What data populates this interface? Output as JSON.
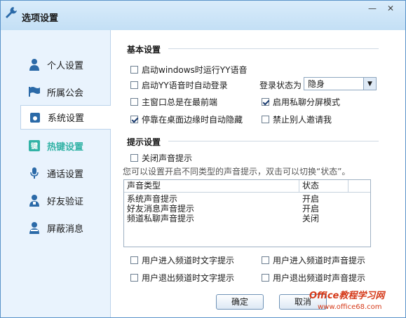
{
  "window": {
    "title": "选项设置",
    "minimize_icon": "minimize-icon",
    "close_icon": "close-icon"
  },
  "sidebar": {
    "items": [
      {
        "label": "个人设置",
        "icon": "person-icon"
      },
      {
        "label": "所属公会",
        "icon": "flag-icon"
      },
      {
        "label": "系统设置",
        "icon": "system-icon",
        "active": true
      },
      {
        "label": "热键设置",
        "icon": "key-icon"
      },
      {
        "label": "通话设置",
        "icon": "microphone-icon"
      },
      {
        "label": "好友验证",
        "icon": "friend-verify-icon"
      },
      {
        "label": "屏蔽消息",
        "icon": "block-icon"
      }
    ]
  },
  "basic": {
    "title": "基本设置",
    "opt_autostart": "启动windows时运行YY语音",
    "opt_autologin": "启动YY语音时自动登录",
    "opt_topmost": "主窗口总是在最前端",
    "opt_autohide": "停靠在桌面边缘时自动隐藏",
    "opt_splitchat": "启用私聊分屏模式",
    "opt_noinvite": "禁止别人邀请我",
    "login_status_label": "登录状态为",
    "login_status_value": "隐身"
  },
  "prompt": {
    "title": "提示设置",
    "opt_mute": "关闭声音提示",
    "hint": "您可以设置开启不同类型的声音提示，双击可以切换“状态”。",
    "table": {
      "col_type": "声音类型",
      "col_status": "状态",
      "rows": [
        {
          "type": "系统声音提示",
          "status": "开启"
        },
        {
          "type": "好友消息声音提示",
          "status": "开启"
        },
        {
          "type": "频道私聊声音提示",
          "status": "关闭"
        }
      ]
    },
    "opt_enter_text": "用户进入频道时文字提示",
    "opt_enter_sound": "用户进入频道时声音提示",
    "opt_exit_text": "用户退出频道时文字提示",
    "opt_exit_sound": "用户退出频道时声音提示"
  },
  "buttons": {
    "ok": "确定",
    "cancel": "取消"
  },
  "watermark": {
    "line1": "Office教程学习网",
    "line2": "www.office68.com"
  },
  "colors": {
    "accent": "#33b3a6",
    "icon_blue": "#2b6aa8",
    "border": "#5a93c9"
  }
}
